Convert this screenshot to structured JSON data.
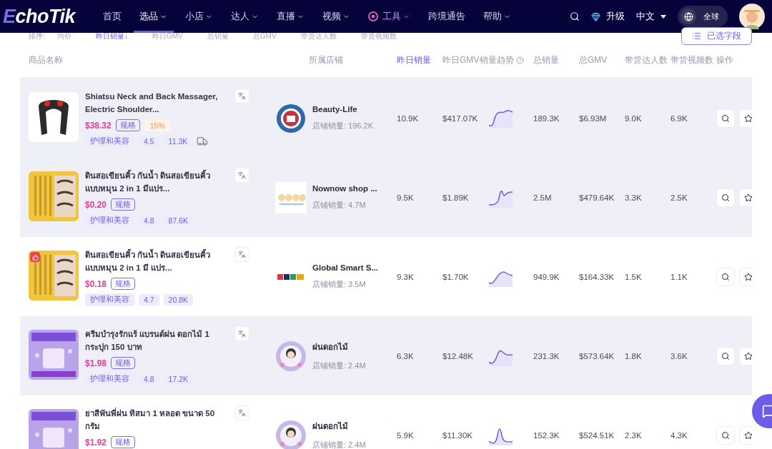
{
  "nav": {
    "logo": "EchoTik",
    "items": [
      {
        "label": "首页",
        "selected": false,
        "dropdown": false,
        "kind": "plain"
      },
      {
        "label": "选品",
        "selected": true,
        "dropdown": true,
        "kind": "plain"
      },
      {
        "label": "小店",
        "selected": false,
        "dropdown": true,
        "kind": "plain"
      },
      {
        "label": "达人",
        "selected": false,
        "dropdown": true,
        "kind": "plain"
      },
      {
        "label": "直播",
        "selected": false,
        "dropdown": true,
        "kind": "plain"
      },
      {
        "label": "视频",
        "selected": false,
        "dropdown": true,
        "kind": "plain"
      },
      {
        "label": "工具",
        "selected": false,
        "dropdown": true,
        "kind": "tool"
      },
      {
        "label": "跨境通告",
        "selected": false,
        "dropdown": false,
        "kind": "plain"
      },
      {
        "label": "帮助",
        "selected": false,
        "dropdown": true,
        "kind": "plain"
      }
    ],
    "upgrade": "升级",
    "language": "中文",
    "region": "全球"
  },
  "sort": {
    "label": "排序:",
    "options": [
      {
        "label": "均价",
        "selected": false
      },
      {
        "label": "昨日销量↓",
        "selected": true
      },
      {
        "label": "昨日GMV",
        "selected": false
      },
      {
        "label": "总销量",
        "selected": false
      },
      {
        "label": "总GMV",
        "selected": false
      },
      {
        "label": "带货达人数",
        "selected": false
      },
      {
        "label": "带货视频数",
        "selected": false
      }
    ],
    "fields_button": "已选字段"
  },
  "table": {
    "columns": [
      {
        "label": "商品名称",
        "selected": false,
        "help": false
      },
      {
        "label": "所属店铺",
        "selected": false,
        "help": false
      },
      {
        "label": "昨日销量",
        "selected": true,
        "help": false
      },
      {
        "label": "昨日GMV",
        "selected": false,
        "help": false
      },
      {
        "label": "销量趋势",
        "selected": false,
        "help": true
      },
      {
        "label": "总销量",
        "selected": false,
        "help": false
      },
      {
        "label": "总GMV",
        "selected": false,
        "help": false
      },
      {
        "label": "带货达人数",
        "selected": false,
        "help": false
      },
      {
        "label": "带货视频数",
        "selected": false,
        "help": false
      },
      {
        "label": "操作",
        "selected": false,
        "help": false
      }
    ],
    "rows": [
      {
        "highlighted": true,
        "badge": false,
        "title": "Shiatsu Neck and Back Massager, Electric Shoulder...",
        "price": "$38.32",
        "spec": "规格",
        "commission": "15%",
        "tags": [
          "护理和美容",
          "4.5",
          "11.3K"
        ],
        "shipping": true,
        "shop": {
          "name": "Beauty-Life",
          "sales": "店铺销量: 196.2K"
        },
        "yesterday_sales": "10.9K",
        "yesterday_gmv": "$417.07K",
        "total_sales": "189.3K",
        "total_gmv": "$6.93M",
        "creators": "9.0K",
        "videos": "6.9K"
      },
      {
        "highlighted": true,
        "badge": false,
        "title": "ดินสอเขียนคิ้ว กันน้ำ ดินสอเขียนคิ้วแบบหมุน 2 in 1 มีแปร...",
        "price": "$0.20",
        "spec": "规格",
        "tags": [
          "护理和美容",
          "4.8",
          "87.6K"
        ],
        "shipping": false,
        "shop": {
          "name": "Nownow shop ...",
          "sales": "店铺销量: 4.7M"
        },
        "yesterday_sales": "9.5K",
        "yesterday_gmv": "$1.89K",
        "total_sales": "2.5M",
        "total_gmv": "$479.64K",
        "creators": "3.3K",
        "videos": "2.5K"
      },
      {
        "highlighted": false,
        "badge": true,
        "title": "ดินสอเขียนคิ้ว กันน้ำ ดินสอเขียนคิ้วแบบหมุน 2 in 1 มี แปร...",
        "price": "$0.18",
        "spec": "规格",
        "tags": [
          "护理和美容",
          "4.7",
          "20.8K"
        ],
        "shipping": false,
        "shop": {
          "name": "Global Smart S...",
          "sales": "店铺销量: 3.5M"
        },
        "yesterday_sales": "9.3K",
        "yesterday_gmv": "$1.70K",
        "total_sales": "949.9K",
        "total_gmv": "$164.33K",
        "creators": "1.5K",
        "videos": "1.1K"
      },
      {
        "highlighted": true,
        "badge": false,
        "title": "ครีมบำรุงรักแร้ แบรนด์ฝน ดอกไม้ 1 กระปุก 150 บาท",
        "price": "$1.98",
        "spec": "规格",
        "tags": [
          "护理和美容",
          "4.8",
          "17.2K"
        ],
        "shipping": false,
        "shop": {
          "name": "ฝนดอกไม้",
          "sales": "店铺销量: 2.4M"
        },
        "yesterday_sales": "6.3K",
        "yesterday_gmv": "$12.48K",
        "total_sales": "231.3K",
        "total_gmv": "$573.64K",
        "creators": "1.8K",
        "videos": "3.6K"
      },
      {
        "highlighted": false,
        "badge": false,
        "title": "ยาสีฟันพี่ฝน ทิสมา 1 หลอด ขนาด 50 กรัม",
        "price": "$1.92",
        "spec": "规格",
        "tags": [],
        "shop": {
          "name": "ฝนดอกไม้",
          "sales": "店铺销量: 2.4M"
        },
        "yesterday_sales": "5.9K",
        "yesterday_gmv": "$11.30K",
        "total_sales": "152.3K",
        "total_gmv": "$524.51K",
        "creators": "2.3K",
        "videos": "4.3K"
      }
    ]
  }
}
